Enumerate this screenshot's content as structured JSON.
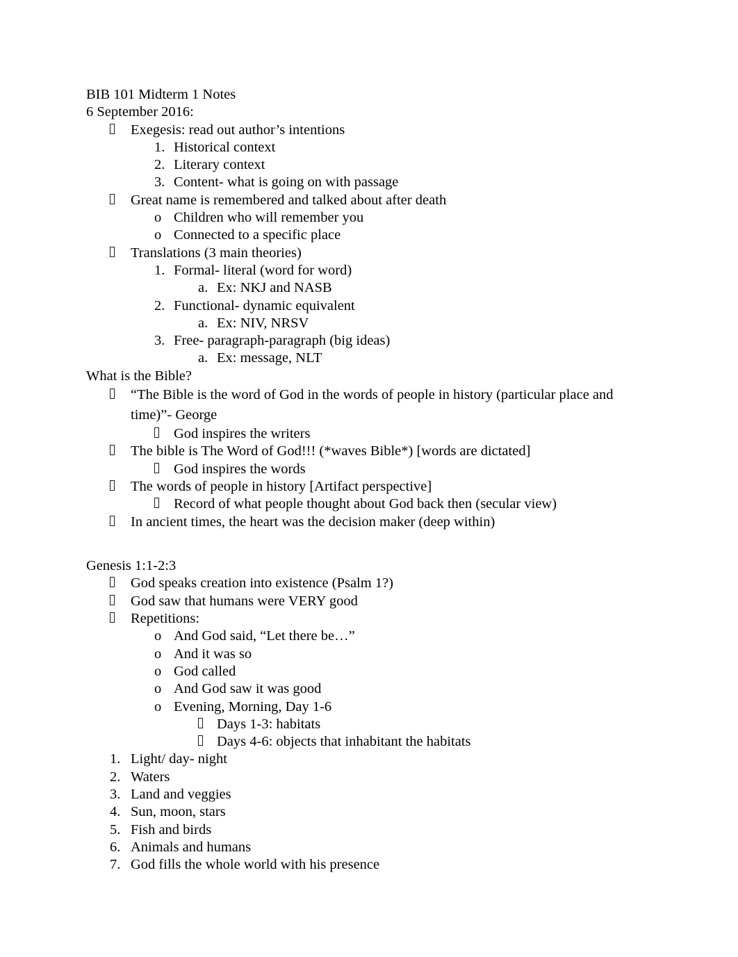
{
  "document": {
    "title": "BIB 101 Midterm 1 Notes",
    "date": "6 September 2016:"
  },
  "markers": {
    "tofu": "",
    "circle": "o",
    "num1": "1.",
    "num2": "2.",
    "num3": "3.",
    "num4": "4.",
    "num5": "5.",
    "num6": "6.",
    "num7": "7.",
    "alpha_a": "a."
  },
  "sections": {
    "sept6": {
      "items": [
        {
          "marker": "tofu",
          "text": "Exegesis: read out author’s intentions",
          "children": [
            {
              "marker": "1.",
              "text": "Historical context"
            },
            {
              "marker": "2.",
              "text": "Literary context"
            },
            {
              "marker": "3.",
              "text": "Content- what is going on with passage"
            }
          ]
        },
        {
          "marker": "tofu",
          "text": "Great name is remembered and talked about after death",
          "children": [
            {
              "marker": "o",
              "text": "Children who will remember you"
            },
            {
              "marker": "o",
              "text": "Connected to a specific place"
            }
          ]
        },
        {
          "marker": "tofu",
          "text": "Translations (3 main theories)",
          "children": [
            {
              "marker": "1.",
              "text": "Formal- literal (word for word)",
              "children": [
                {
                  "marker": "a.",
                  "text": "Ex: NKJ and NASB"
                }
              ]
            },
            {
              "marker": "2.",
              "text": "Functional- dynamic equivalent",
              "children": [
                {
                  "marker": "a.",
                  "text": "Ex: NIV, NRSV"
                }
              ]
            },
            {
              "marker": "3.",
              "text": "Free- paragraph-paragraph (big ideas)",
              "children": [
                {
                  "marker": "a.",
                  "text": "Ex: message, NLT"
                }
              ]
            }
          ]
        }
      ]
    },
    "bible": {
      "heading": "What is the Bible?",
      "items": [
        {
          "marker": "tofu",
          "text": "“The Bible is the word of God in the words of people in history (particular place and time)”- George",
          "children": [
            {
              "marker": "tofu",
              "text": "God inspires the writers"
            }
          ]
        },
        {
          "marker": "tofu",
          "text": "The bible is The Word of God!!! (*waves Bible*) [words are dictated]",
          "children": [
            {
              "marker": "tofu",
              "text": "God inspires the words"
            }
          ]
        },
        {
          "marker": "tofu",
          "text": "The words of people in history [Artifact perspective]",
          "children": [
            {
              "marker": "tofu",
              "text": "Record of what people thought about God back then (secular view)"
            }
          ]
        },
        {
          "marker": "tofu",
          "text": "In ancient times, the heart was the decision maker (deep within)"
        }
      ]
    },
    "genesis": {
      "heading": "Genesis 1:1-2:3",
      "items": [
        {
          "marker": "tofu",
          "text": "God speaks creation into existence (Psalm 1?)"
        },
        {
          "marker": "tofu",
          "text": "God saw that humans were VERY good"
        },
        {
          "marker": "tofu",
          "text": "Repetitions:",
          "children": [
            {
              "marker": "o",
              "text": "And God said, “Let there be…”"
            },
            {
              "marker": "o",
              "text": "And it was so"
            },
            {
              "marker": "o",
              "text": "God called"
            },
            {
              "marker": "o",
              "text": "And God saw it was good"
            },
            {
              "marker": "o",
              "text": "Evening, Morning, Day 1-6",
              "children": [
                {
                  "marker": "tofu",
                  "text": "Days 1-3: habitats"
                },
                {
                  "marker": "tofu",
                  "text": "Days 4-6: objects that inhabitant the habitats"
                }
              ]
            }
          ]
        }
      ],
      "days": [
        {
          "marker": "1.",
          "text": "Light/ day- night"
        },
        {
          "marker": "2.",
          "text": "Waters"
        },
        {
          "marker": "3.",
          "text": "Land and veggies"
        },
        {
          "marker": "4.",
          "text": "Sun, moon, stars"
        },
        {
          "marker": "5.",
          "text": "Fish and birds"
        },
        {
          "marker": "6.",
          "text": "Animals and humans"
        },
        {
          "marker": "7.",
          "text": "God fills the whole world with his presence"
        }
      ]
    }
  }
}
